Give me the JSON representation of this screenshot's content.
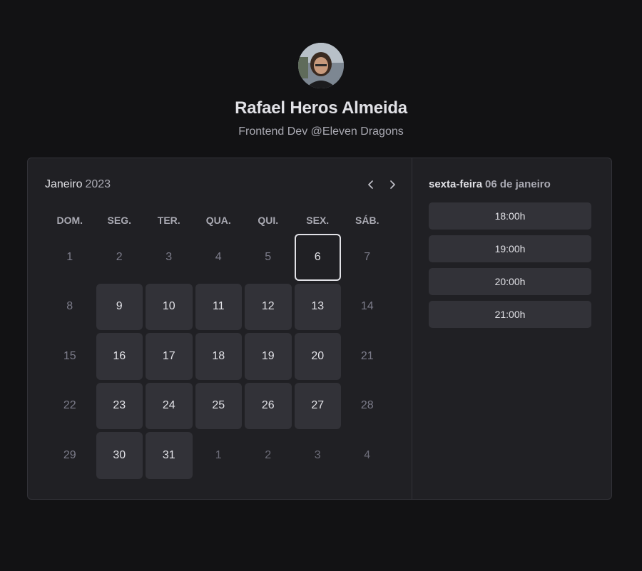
{
  "profile": {
    "name": "Rafael Heros Almeida",
    "bio": "Frontend Dev @Eleven Dragons"
  },
  "calendar": {
    "month": "Janeiro",
    "year": "2023",
    "weekdays": [
      "DOM.",
      "SEG.",
      "TER.",
      "QUA.",
      "QUI.",
      "SEX.",
      "SÁB."
    ],
    "days": [
      {
        "label": "1",
        "state": "disabled"
      },
      {
        "label": "2",
        "state": "disabled"
      },
      {
        "label": "3",
        "state": "disabled"
      },
      {
        "label": "4",
        "state": "disabled"
      },
      {
        "label": "5",
        "state": "disabled"
      },
      {
        "label": "6",
        "state": "selected"
      },
      {
        "label": "7",
        "state": "disabled"
      },
      {
        "label": "8",
        "state": "disabled"
      },
      {
        "label": "9",
        "state": "available"
      },
      {
        "label": "10",
        "state": "available"
      },
      {
        "label": "11",
        "state": "available"
      },
      {
        "label": "12",
        "state": "available"
      },
      {
        "label": "13",
        "state": "available"
      },
      {
        "label": "14",
        "state": "disabled"
      },
      {
        "label": "15",
        "state": "disabled"
      },
      {
        "label": "16",
        "state": "available"
      },
      {
        "label": "17",
        "state": "available"
      },
      {
        "label": "18",
        "state": "available"
      },
      {
        "label": "19",
        "state": "available"
      },
      {
        "label": "20",
        "state": "available"
      },
      {
        "label": "21",
        "state": "disabled"
      },
      {
        "label": "22",
        "state": "disabled"
      },
      {
        "label": "23",
        "state": "available"
      },
      {
        "label": "24",
        "state": "available"
      },
      {
        "label": "25",
        "state": "available"
      },
      {
        "label": "26",
        "state": "available"
      },
      {
        "label": "27",
        "state": "available"
      },
      {
        "label": "28",
        "state": "disabled"
      },
      {
        "label": "29",
        "state": "disabled"
      },
      {
        "label": "30",
        "state": "available"
      },
      {
        "label": "31",
        "state": "available"
      },
      {
        "label": "1",
        "state": "disabled"
      },
      {
        "label": "2",
        "state": "disabled"
      },
      {
        "label": "3",
        "state": "disabled"
      },
      {
        "label": "4",
        "state": "disabled"
      }
    ]
  },
  "selected": {
    "weekday": "sexta-feira",
    "date": "06 de janeiro"
  },
  "times": [
    "18:00h",
    "19:00h",
    "20:00h",
    "21:00h"
  ],
  "icons": {
    "prev": "chevron-left-icon",
    "next": "chevron-right-icon"
  },
  "colors": {
    "background": "#121214",
    "panel": "#202024",
    "available_day": "#323238",
    "text": "#e1e1e6",
    "muted_text": "#a9a9b2"
  }
}
